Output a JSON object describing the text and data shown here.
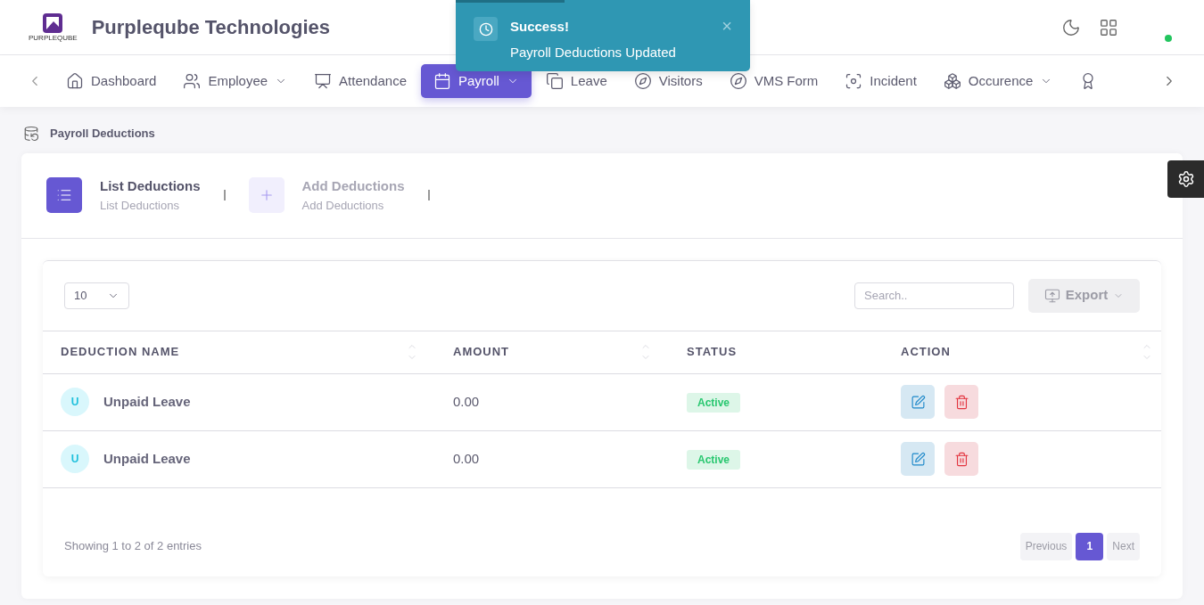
{
  "header": {
    "logo_text": "PURPLEQUBE",
    "company": "Purpleqube Technologies",
    "online": true
  },
  "toast": {
    "title": "Success!",
    "message": "Payroll Deductions Updated",
    "close": "×",
    "level": 0.37
  },
  "nav": [
    {
      "label": "Dashboard",
      "dropdown": false,
      "selected": false
    },
    {
      "label": "Employee",
      "dropdown": true,
      "selected": false
    },
    {
      "label": "Attendance",
      "dropdown": false,
      "selected": false
    },
    {
      "label": "Payroll",
      "dropdown": true,
      "selected": true
    },
    {
      "label": "Leave",
      "dropdown": false,
      "selected": false
    },
    {
      "label": "Visitors",
      "dropdown": false,
      "selected": false
    },
    {
      "label": "VMS Form",
      "dropdown": false,
      "selected": false
    },
    {
      "label": "Incident",
      "dropdown": false,
      "selected": false
    },
    {
      "label": "Occurence",
      "dropdown": true,
      "selected": false
    },
    {
      "dropdown": false,
      "selected": false
    }
  ],
  "breadcrumb": "Payroll Deductions",
  "tabs": [
    {
      "title": "List Deductions",
      "subtitle": "List Deductions",
      "selected": true
    },
    {
      "title": "Add Deductions",
      "subtitle": "Add Deductions",
      "selected": false
    }
  ],
  "table": {
    "page_size": "10",
    "search_placeholder": "Search..",
    "export": "Export",
    "columns": [
      {
        "label": "DEDUCTION NAME",
        "sortable": true
      },
      {
        "label": "AMOUNT",
        "sortable": true
      },
      {
        "label": "STATUS",
        "sortable": false
      },
      {
        "label": "ACTION",
        "sortable": true
      }
    ],
    "rows": [
      {
        "initial": "U",
        "name": "Unpaid Leave",
        "amount": "0.00",
        "status": "Active",
        "active": true
      },
      {
        "initial": "U",
        "name": "Unpaid Leave",
        "amount": "0.00",
        "status": "Active",
        "active": true
      }
    ],
    "summary": "Showing 1 to 2 of 2 entries",
    "pagination": [
      {
        "label": "Previous",
        "kind": "prev",
        "selected": false
      },
      {
        "label": "1",
        "kind": "page",
        "selected": true
      },
      {
        "label": "Next",
        "kind": "next",
        "selected": false
      }
    ]
  }
}
